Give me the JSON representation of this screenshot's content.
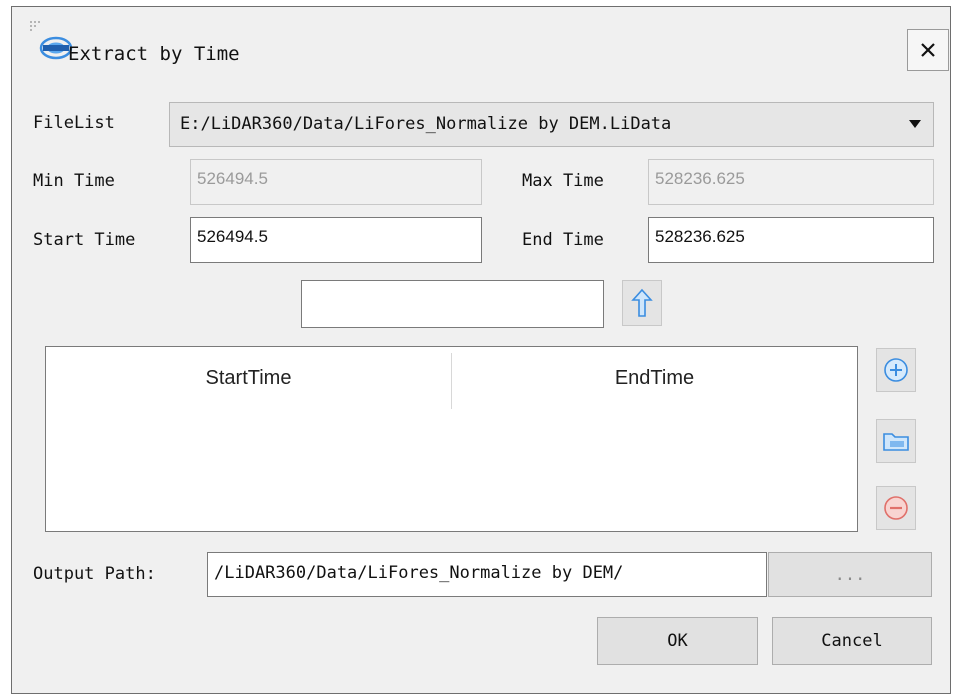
{
  "dialog": {
    "title": "Extract by Time",
    "icons": {
      "app": "lidar360-logo-icon",
      "close": "close-icon"
    }
  },
  "file_list": {
    "label": "FileList",
    "selected": "E:/LiDAR360/Data/LiFores_Normalize by DEM.LiData"
  },
  "time": {
    "min_label": "Min Time",
    "min_value": "526494.5",
    "max_label": "Max Time",
    "max_value": "528236.625",
    "start_label": "Start Time",
    "start_value": "526494.5",
    "end_label": "End Time",
    "end_value": "528236.625"
  },
  "time_input": {
    "value": "",
    "icon": "up-arrow-icon"
  },
  "table": {
    "columns": [
      "StartTime",
      "EndTime"
    ],
    "rows": []
  },
  "side_buttons": {
    "add": "add-icon",
    "open": "folder-icon",
    "remove": "remove-icon"
  },
  "output": {
    "label": "Output Path:",
    "value": "/LiDAR360/Data/LiFores_Normalize by DEM/",
    "browse_label": "..."
  },
  "buttons": {
    "ok": "OK",
    "cancel": "Cancel"
  },
  "colors": {
    "accent_blue": "#3b8de0",
    "remove_red": "#e0706a",
    "readonly_text": "#9a9a9a"
  }
}
